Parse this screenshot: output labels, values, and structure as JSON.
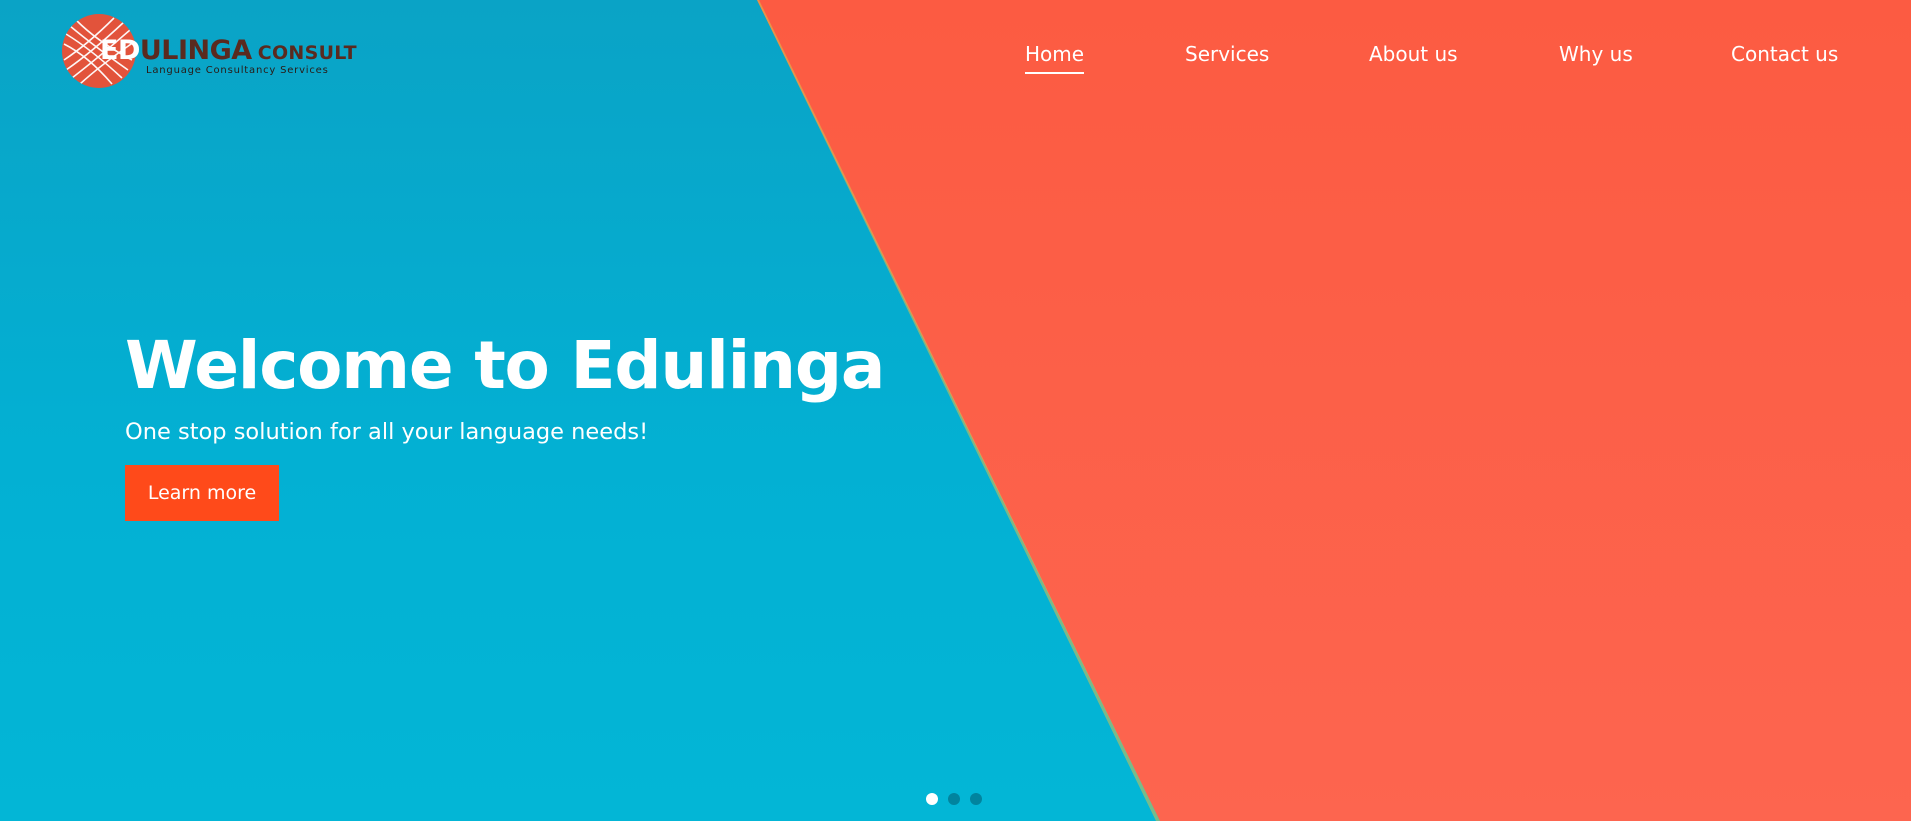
{
  "logo": {
    "word_highlight": "ED",
    "word_rest": "ULINGA",
    "word_suffix": "CONSULT",
    "tagline": "Language Consultancy Services",
    "icon": "edulinga-logo-icon"
  },
  "nav": {
    "items": [
      {
        "label": "Home",
        "active": true
      },
      {
        "label": "Services",
        "active": false
      },
      {
        "label": "About us",
        "active": false
      },
      {
        "label": "Why us",
        "active": false
      },
      {
        "label": "Contact us",
        "active": false
      }
    ]
  },
  "hero": {
    "title": "Welcome to Edulinga",
    "subtitle": "One stop solution for all your language needs!",
    "cta_label": "Learn more"
  },
  "carousel": {
    "slide_count": 3,
    "active_index": 0
  },
  "colors": {
    "blue_panel": "#03b0d3",
    "coral_panel": "#fd604a",
    "cta_button": "#ff4a1a",
    "logo_circle": "#e2533b",
    "logo_text_dark": "#5a2a1f",
    "text": "#ffffff"
  }
}
